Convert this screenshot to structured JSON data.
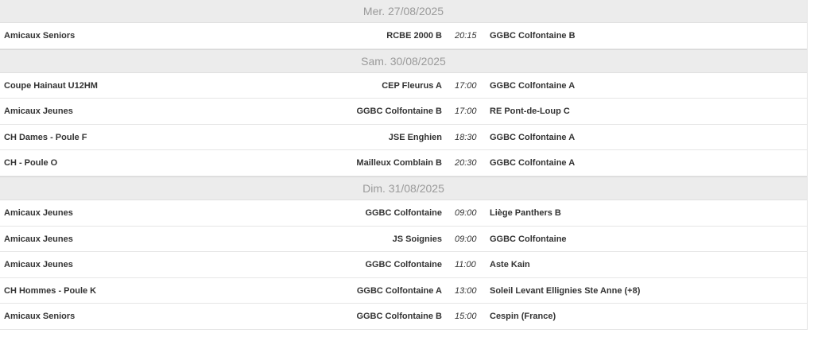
{
  "days": [
    {
      "date": "Mer. 27/08/2025",
      "matches": [
        {
          "competition": "Amicaux Seniors",
          "home": "RCBE 2000 B",
          "time": "20:15",
          "away": "GGBC Colfontaine B"
        }
      ]
    },
    {
      "date": "Sam. 30/08/2025",
      "matches": [
        {
          "competition": "Coupe Hainaut U12HM",
          "home": "CEP Fleurus A",
          "time": "17:00",
          "away": "GGBC Colfontaine A"
        },
        {
          "competition": "Amicaux Jeunes",
          "home": "GGBC Colfontaine B",
          "time": "17:00",
          "away": "RE Pont-de-Loup C"
        },
        {
          "competition": "CH Dames - Poule F",
          "home": "JSE Enghien",
          "time": "18:30",
          "away": "GGBC Colfontaine A"
        },
        {
          "competition": "CH - Poule O",
          "home": "Mailleux Comblain B",
          "time": "20:30",
          "away": "GGBC Colfontaine A"
        }
      ]
    },
    {
      "date": "Dim. 31/08/2025",
      "matches": [
        {
          "competition": "Amicaux Jeunes",
          "home": "GGBC Colfontaine",
          "time": "09:00",
          "away": "Liège Panthers B"
        },
        {
          "competition": "Amicaux Jeunes",
          "home": "JS Soignies",
          "time": "09:00",
          "away": "GGBC Colfontaine"
        },
        {
          "competition": "Amicaux Jeunes",
          "home": "GGBC Colfontaine",
          "time": "11:00",
          "away": "Aste Kain"
        },
        {
          "competition": "CH Hommes - Poule K",
          "home": "GGBC Colfontaine A",
          "time": "13:00",
          "away": "Soleil Levant Ellignies Ste Anne (+8)"
        },
        {
          "competition": "Amicaux Seniors",
          "home": "GGBC Colfontaine B",
          "time": "15:00",
          "away": "Cespin (France)"
        }
      ]
    }
  ]
}
